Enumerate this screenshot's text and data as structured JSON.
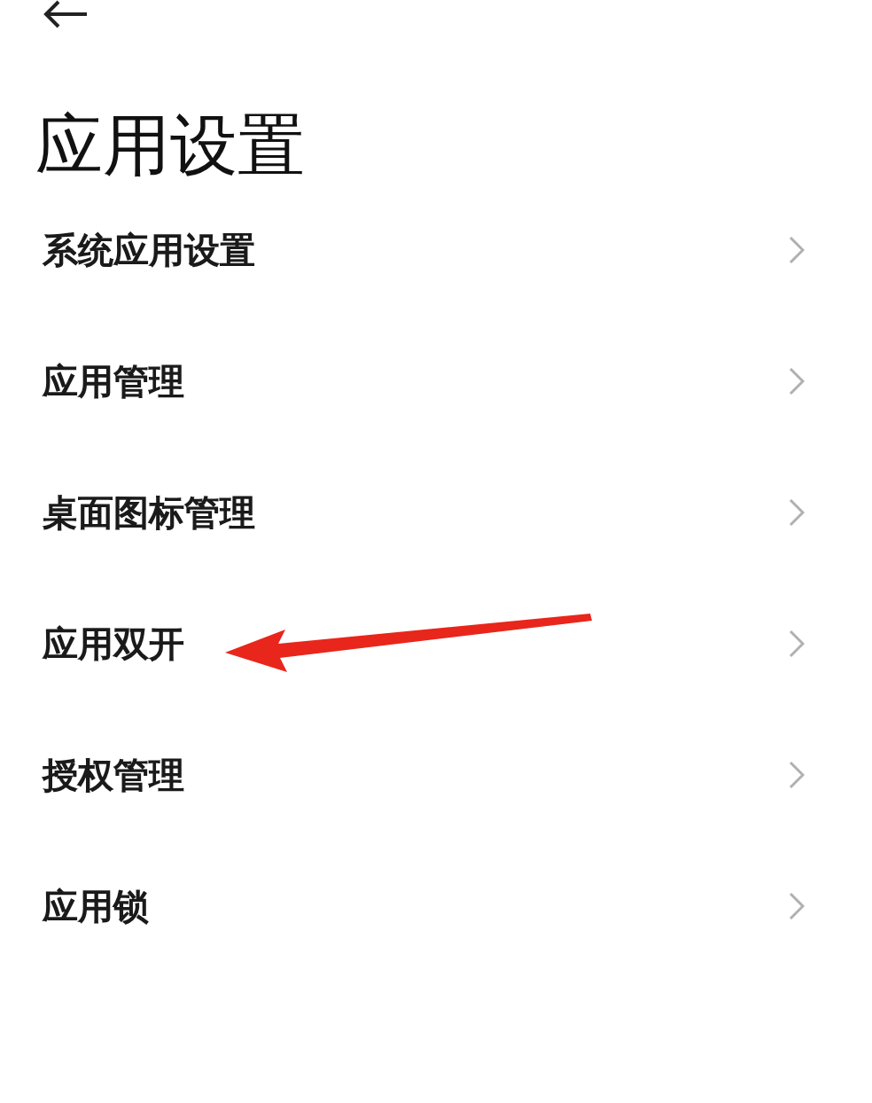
{
  "title": "应用设置",
  "items": [
    {
      "label": "系统应用设置",
      "pointed": false
    },
    {
      "label": "应用管理",
      "pointed": false
    },
    {
      "label": "桌面图标管理",
      "pointed": false
    },
    {
      "label": "应用双开",
      "pointed": true
    },
    {
      "label": "授权管理",
      "pointed": false
    },
    {
      "label": "应用锁",
      "pointed": false
    }
  ]
}
